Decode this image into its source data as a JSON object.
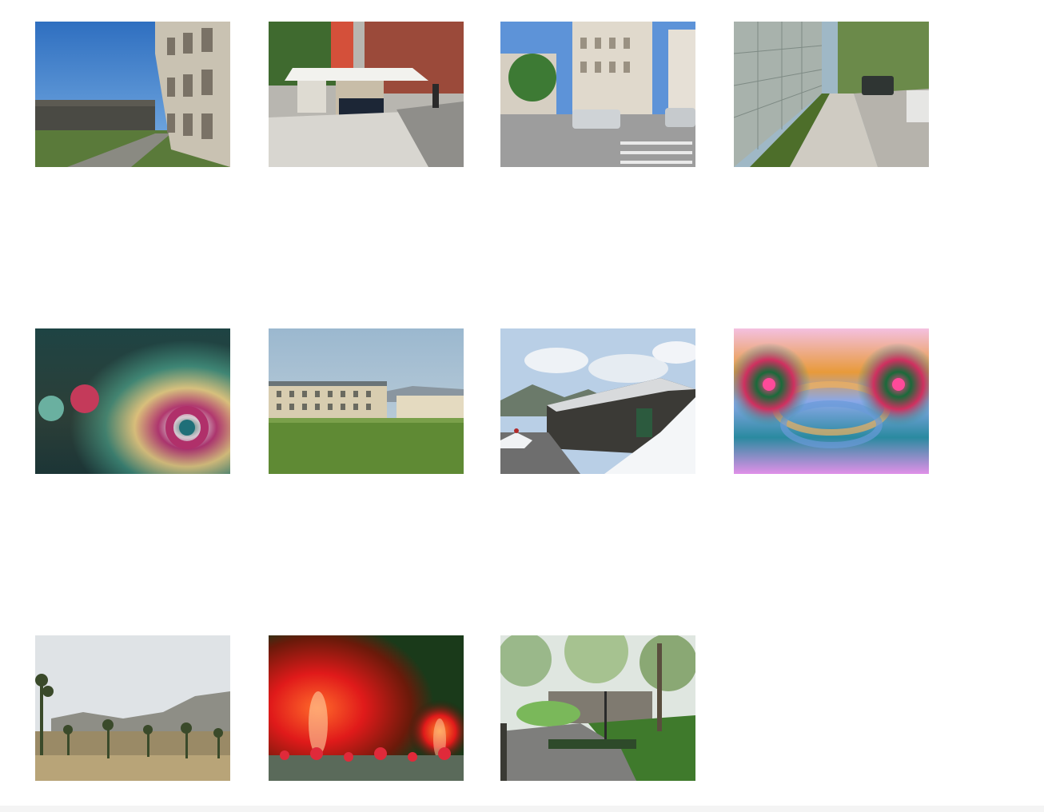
{
  "gallery": {
    "thumbnails": [
      {
        "icon": "courtyard-building-photo"
      },
      {
        "icon": "street-market-tents-photo"
      },
      {
        "icon": "city-intersection-photo"
      },
      {
        "icon": "sidewalk-wall-photo"
      },
      {
        "icon": "swirl-fractal-art"
      },
      {
        "icon": "field-buildings-photo"
      },
      {
        "icon": "snowy-cabin-photo"
      },
      {
        "icon": "spiral-fractal-art"
      },
      {
        "icon": "desert-joshua-trees-photo"
      },
      {
        "icon": "red-fractal-art"
      },
      {
        "icon": "park-path-photo"
      }
    ]
  }
}
